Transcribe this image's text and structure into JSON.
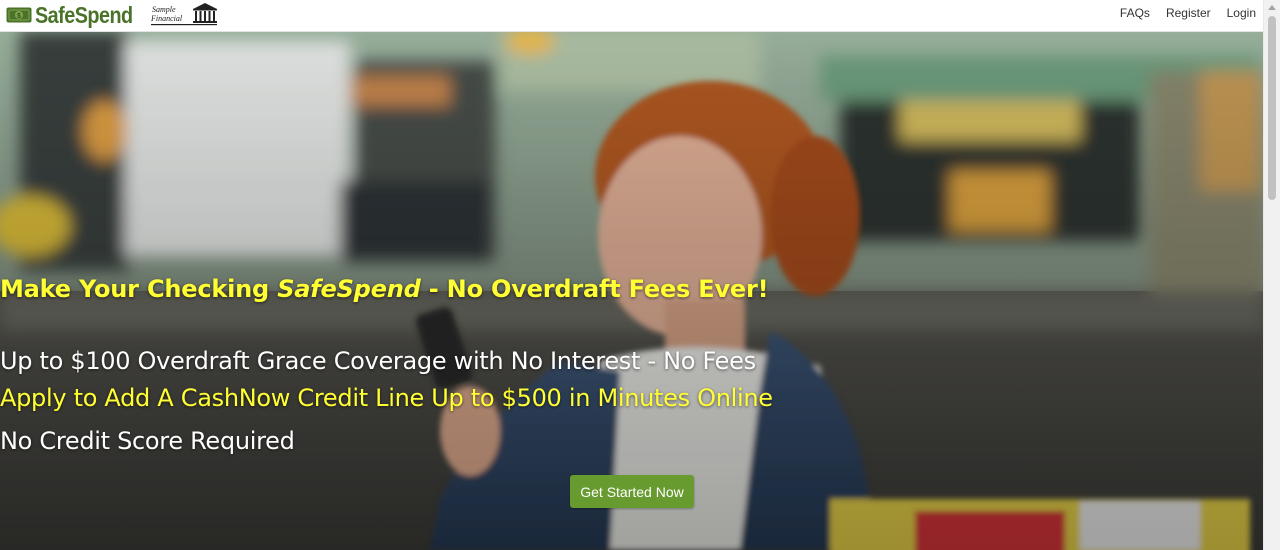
{
  "header": {
    "brand_name": "SafeSpend",
    "partner_logo_text": [
      "Sample",
      "Financial"
    ],
    "nav": [
      {
        "label": "FAQs"
      },
      {
        "label": "Register"
      },
      {
        "label": "Login"
      }
    ]
  },
  "hero": {
    "headline_prefix": "Make Your Checking ",
    "headline_emphasis": "SafeSpend",
    "headline_suffix": " - No Overdraft Fees Ever!",
    "line_1": "Up to $100 Overdraft Grace Coverage with No Interest - No Fees",
    "line_2": "Apply to Add A CashNow Credit Line Up to $500 in Minutes Online",
    "line_3": "No Credit Score Required",
    "cta_label": "Get Started Now",
    "background_image": "woman-with-phone-street-photo"
  },
  "colors": {
    "brand_green": "#4a7228",
    "cta_green": "#689b2f",
    "highlight_yellow": "#ffff33",
    "white": "#ffffff"
  },
  "icons": {
    "brand": "money-bill-icon",
    "partner": "bank-building-icon"
  }
}
